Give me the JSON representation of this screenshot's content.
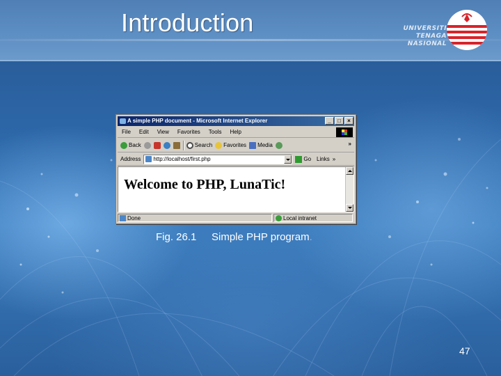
{
  "slide": {
    "title": "Introduction",
    "logo": {
      "line1": "UNIVERSITI",
      "line2": "TENAGA",
      "line3": "NASIONAL"
    },
    "caption": {
      "figure": "Fig. 26.1",
      "text": "Simple PHP program",
      "period": "."
    },
    "page_number": "47"
  },
  "browser": {
    "window_title": "A simple PHP document - Microsoft Internet Explorer",
    "window_buttons": [
      "_",
      "□",
      "×"
    ],
    "menu": [
      "File",
      "Edit",
      "View",
      "Favorites",
      "Tools",
      "Help"
    ],
    "toolbar": {
      "back": "Back",
      "search": "Search",
      "favorites": "Favorites",
      "media": "Media",
      "more": "»"
    },
    "address": {
      "label": "Address",
      "value": "http://localhost/first.php",
      "go": "Go",
      "links": "Links",
      "more": "»"
    },
    "content": {
      "heading": "Welcome to PHP, LunaTic!"
    },
    "status": {
      "text": "Done",
      "zone": "Local intranet"
    }
  }
}
